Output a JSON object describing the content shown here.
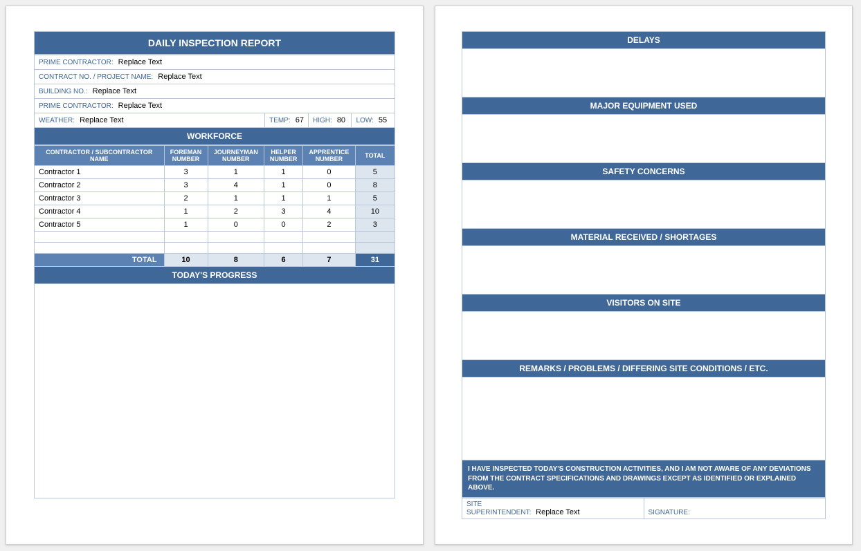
{
  "title": "DAILY INSPECTION REPORT",
  "info": {
    "prime_contractor_label": "PRIME CONTRACTOR:",
    "prime_contractor_value": "Replace Text",
    "contract_no_label": "CONTRACT NO. / PROJECT NAME:",
    "contract_no_value": "Replace Text",
    "building_no_label": "BUILDING NO.:",
    "building_no_value": "Replace Text",
    "prime_contractor2_label": "PRIME CONTRACTOR:",
    "prime_contractor2_value": "Replace Text",
    "weather_label": "WEATHER:",
    "weather_value": "Replace Text",
    "temp_label": "TEMP:",
    "temp_value": "67",
    "high_label": "HIGH:",
    "high_value": "80",
    "low_label": "LOW:",
    "low_value": "55"
  },
  "workforce": {
    "header": "WORKFORCE",
    "cols": [
      "CONTRACTOR / SUBCONTRACTOR NAME",
      "FOREMAN NUMBER",
      "JOURNEYMAN NUMBER",
      "HELPER NUMBER",
      "APPRENTICE NUMBER",
      "TOTAL"
    ],
    "rows": [
      {
        "name": "Contractor 1",
        "foreman": "3",
        "journey": "1",
        "helper": "1",
        "appr": "0",
        "total": "5"
      },
      {
        "name": "Contractor 2",
        "foreman": "3",
        "journey": "4",
        "helper": "1",
        "appr": "0",
        "total": "8"
      },
      {
        "name": "Contractor 3",
        "foreman": "2",
        "journey": "1",
        "helper": "1",
        "appr": "1",
        "total": "5"
      },
      {
        "name": "Contractor 4",
        "foreman": "1",
        "journey": "2",
        "helper": "3",
        "appr": "4",
        "total": "10"
      },
      {
        "name": "Contractor 5",
        "foreman": "1",
        "journey": "0",
        "helper": "0",
        "appr": "2",
        "total": "3"
      }
    ],
    "total_label": "TOTAL",
    "totals": {
      "foreman": "10",
      "journey": "8",
      "helper": "6",
      "appr": "7",
      "total": "31"
    }
  },
  "progress_header": "TODAY'S PROGRESS",
  "p2": {
    "delays": "DELAYS",
    "equipment": "MAJOR EQUIPMENT USED",
    "safety": "SAFETY CONCERNS",
    "material": "MATERIAL RECEIVED / SHORTAGES",
    "visitors": "VISITORS ON SITE",
    "remarks": "REMARKS / PROBLEMS / DIFFERING SITE CONDITIONS / ETC.",
    "cert": "I HAVE INSPECTED TODAY'S CONSTRUCTION ACTIVITIES, AND I AM NOT AWARE OF ANY DEVIATIONS FROM THE CONTRACT SPECIFICATIONS AND DRAWINGS EXCEPT AS IDENTIFIED OR EXPLAINED ABOVE.",
    "super_label1": "SITE",
    "super_label2": "SUPERINTENDENT:",
    "super_value": "Replace Text",
    "sig_label": "SIGNATURE:"
  }
}
